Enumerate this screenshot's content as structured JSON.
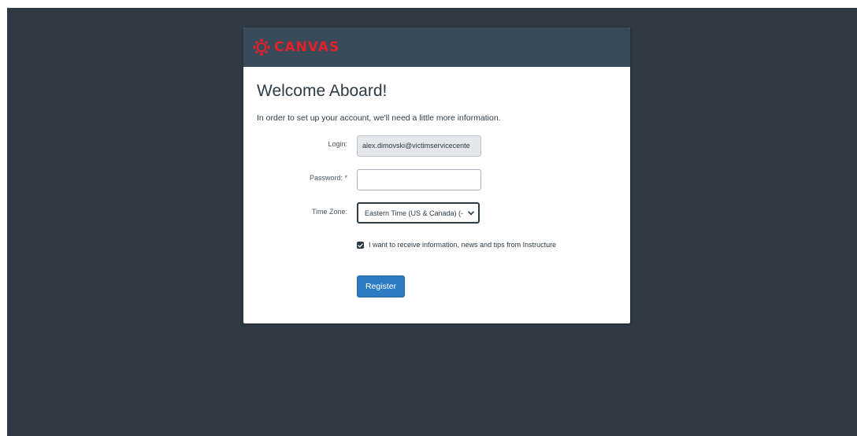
{
  "brand": {
    "name": "CANVAS",
    "logo_icon": "canvas-logo-icon",
    "color": "#e4202b"
  },
  "page": {
    "title": "Welcome Aboard!",
    "intro": "In order to set up your account, we'll need a little more information."
  },
  "form": {
    "login": {
      "label": "Login:",
      "value": "alex.dimovski@victimservicecente"
    },
    "password": {
      "label": "Password: *",
      "value": ""
    },
    "timezone": {
      "label": "Time Zone:",
      "selected": "Eastern Time (US & Canada) (-"
    },
    "newsletter": {
      "label": "I want to receive information, news and tips from Instructure",
      "checked": true
    },
    "submit_label": "Register"
  },
  "colors": {
    "background": "#2f3a45",
    "header": "#394a58",
    "primary_button": "#2d7bc3"
  }
}
